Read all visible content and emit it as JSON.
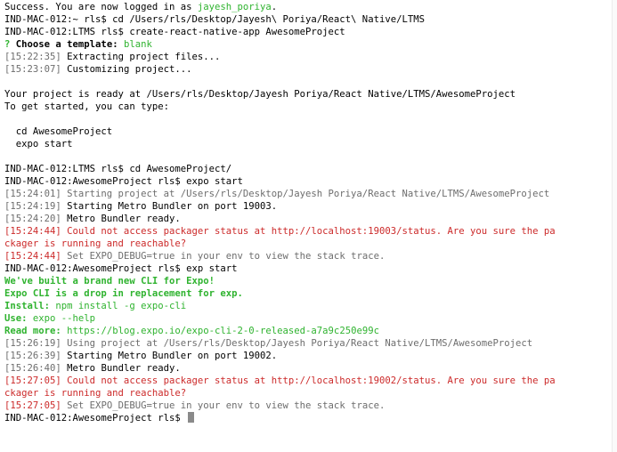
{
  "lines": [
    {
      "parts": [
        {
          "t": "Success. You are now logged in as ",
          "c": ""
        },
        {
          "t": "jayesh_poriya",
          "c": "green"
        },
        {
          "t": ".",
          "c": ""
        }
      ]
    },
    {
      "parts": [
        {
          "t": "IND-MAC-012:~ rls$ cd /Users/rls/Desktop/Jayesh\\ Poriya/React\\ Native/LTMS",
          "c": ""
        }
      ]
    },
    {
      "parts": [
        {
          "t": "IND-MAC-012:LTMS rls$ create-react-native-app AwesomeProject",
          "c": ""
        }
      ]
    },
    {
      "parts": [
        {
          "t": "? ",
          "c": "green-b"
        },
        {
          "t": "Choose a template: ",
          "c": "bold"
        },
        {
          "t": "blank",
          "c": "green"
        }
      ]
    },
    {
      "parts": [
        {
          "t": "[15:22:35] ",
          "c": "gray"
        },
        {
          "t": "Extracting project files...",
          "c": ""
        }
      ]
    },
    {
      "parts": [
        {
          "t": "[15:23:07] ",
          "c": "gray"
        },
        {
          "t": "Customizing project...",
          "c": ""
        }
      ]
    },
    {
      "parts": []
    },
    {
      "parts": [
        {
          "t": "Your project is ready at /Users/rls/Desktop/Jayesh Poriya/React Native/LTMS/AwesomeProject",
          "c": ""
        }
      ]
    },
    {
      "parts": [
        {
          "t": "To get started, you can type:",
          "c": ""
        }
      ]
    },
    {
      "parts": []
    },
    {
      "parts": [
        {
          "t": "  cd AwesomeProject",
          "c": ""
        }
      ]
    },
    {
      "parts": [
        {
          "t": "  expo start",
          "c": ""
        }
      ]
    },
    {
      "parts": []
    },
    {
      "parts": [
        {
          "t": "IND-MAC-012:LTMS rls$ cd AwesomeProject/",
          "c": ""
        }
      ]
    },
    {
      "parts": [
        {
          "t": "IND-MAC-012:AwesomeProject rls$ expo start",
          "c": ""
        }
      ]
    },
    {
      "parts": [
        {
          "t": "[15:24:01] Starting project at /Users/rls/Desktop/Jayesh Poriya/React Native/LTMS/AwesomeProject",
          "c": "gray"
        }
      ]
    },
    {
      "parts": [
        {
          "t": "[15:24:19] ",
          "c": "gray"
        },
        {
          "t": "Starting Metro Bundler on port 19003.",
          "c": ""
        }
      ]
    },
    {
      "parts": [
        {
          "t": "[15:24:20] ",
          "c": "gray"
        },
        {
          "t": "Metro Bundler ready.",
          "c": ""
        }
      ]
    },
    {
      "parts": [
        {
          "t": "[15:24:44] Could not access packager status at http://localhost:19003/status. Are you sure the pa",
          "c": "red"
        }
      ]
    },
    {
      "parts": [
        {
          "t": "ckager is running and reachable?",
          "c": "red"
        }
      ]
    },
    {
      "parts": [
        {
          "t": "[15:24:44] ",
          "c": "red"
        },
        {
          "t": "Set EXPO_DEBUG=true in your env to view the stack trace.",
          "c": "gray"
        }
      ]
    },
    {
      "parts": [
        {
          "t": "IND-MAC-012:AwesomeProject rls$ exp start",
          "c": ""
        }
      ]
    },
    {
      "parts": [
        {
          "t": "We've built a brand new CLI for Expo!",
          "c": "green-b"
        }
      ]
    },
    {
      "parts": [
        {
          "t": "Expo CLI is a drop in replacement for exp.",
          "c": "green-b"
        }
      ]
    },
    {
      "parts": [
        {
          "t": "Install: ",
          "c": "green-b"
        },
        {
          "t": "npm install -g expo-cli",
          "c": "green"
        }
      ]
    },
    {
      "parts": [
        {
          "t": "Use: ",
          "c": "green-b"
        },
        {
          "t": "expo --help",
          "c": "green"
        }
      ]
    },
    {
      "parts": [
        {
          "t": "Read more: ",
          "c": "green-b"
        },
        {
          "t": "https://blog.expo.io/expo-cli-2-0-released-a7a9c250e99c",
          "c": "green"
        }
      ]
    },
    {
      "parts": [
        {
          "t": "[15:26:19] Using project at /Users/rls/Desktop/Jayesh Poriya/React Native/LTMS/AwesomeProject",
          "c": "gray"
        }
      ]
    },
    {
      "parts": [
        {
          "t": "[15:26:39] ",
          "c": "gray"
        },
        {
          "t": "Starting Metro Bundler on port 19002.",
          "c": ""
        }
      ]
    },
    {
      "parts": [
        {
          "t": "[15:26:40] ",
          "c": "gray"
        },
        {
          "t": "Metro Bundler ready.",
          "c": ""
        }
      ]
    },
    {
      "parts": [
        {
          "t": "[15:27:05] Could not access packager status at http://localhost:19002/status. Are you sure the pa",
          "c": "red"
        }
      ]
    },
    {
      "parts": [
        {
          "t": "ckager is running and reachable?",
          "c": "red"
        }
      ]
    },
    {
      "parts": [
        {
          "t": "[15:27:05] ",
          "c": "red"
        },
        {
          "t": "Set EXPO_DEBUG=true in your env to view the stack trace.",
          "c": "gray"
        }
      ]
    },
    {
      "parts": [
        {
          "t": "IND-MAC-012:AwesomeProject rls$ ",
          "c": ""
        }
      ],
      "cursor": true
    }
  ],
  "colors": {
    "background": "#ffffff",
    "text": "#000000",
    "gray": "#6d6d6d",
    "green": "#2fb32f",
    "red": "#cc2a2a"
  }
}
